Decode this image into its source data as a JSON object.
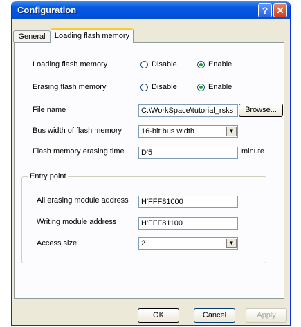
{
  "window": {
    "title": "Configuration",
    "help_label": "?",
    "close_label": "✕"
  },
  "tabs": [
    {
      "label": "General"
    },
    {
      "label": "Loading flash memory"
    }
  ],
  "form": {
    "loading_flash": {
      "label": "Loading flash memory",
      "opt_disable": "Disable",
      "opt_enable": "Enable",
      "selected": "Enable"
    },
    "erasing_flash": {
      "label": "Erasing flash memory",
      "opt_disable": "Disable",
      "opt_enable": "Enable",
      "selected": "Enable"
    },
    "file_name": {
      "label": "File name",
      "value": "C:\\WorkSpace\\tutorial_rsks",
      "browse_label": "Browse..."
    },
    "bus_width": {
      "label": "Bus width of flash memory",
      "value": "16-bit bus width"
    },
    "erase_time": {
      "label": "Flash memory erasing time",
      "value": "D'5",
      "unit": "minute"
    },
    "entry_point": {
      "title": "Entry point",
      "erase_module": {
        "label": "All erasing module address",
        "value": "H'FFF81000"
      },
      "write_module": {
        "label": "Writing module address",
        "value": "H'FFF81100"
      },
      "access_size": {
        "label": "Access size",
        "value": "2"
      }
    }
  },
  "buttons": {
    "ok": "OK",
    "cancel": "Cancel",
    "apply": "Apply"
  }
}
